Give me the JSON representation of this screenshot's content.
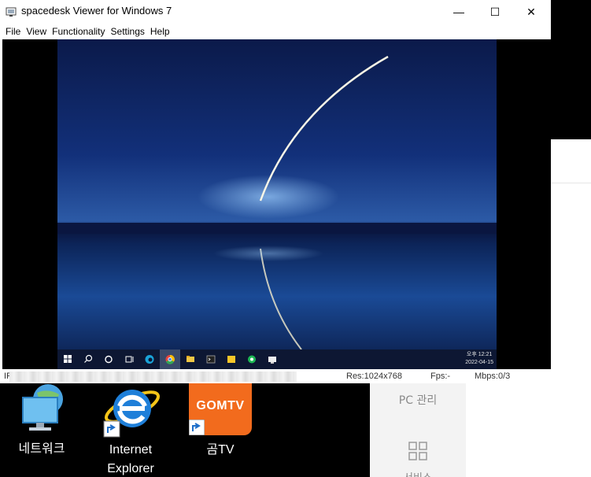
{
  "window": {
    "title": "spacedesk Viewer for Windows 7",
    "min_glyph": "—",
    "max_glyph": "☐",
    "close_glyph": "✕"
  },
  "menu": [
    "File",
    "View",
    "Functionality",
    "Settings",
    "Help"
  ],
  "remote": {
    "clock_time": "오후 12:21",
    "clock_date": "2022-04-15",
    "taskbar_icons": [
      "windows-start-icon",
      "search-icon",
      "cortana-icon",
      "task-view-icon",
      "edge-icon",
      "chrome-icon",
      "file-explorer-icon",
      "terminal-icon",
      "sticky-notes-icon",
      "green-app-icon",
      "spacedesk-icon"
    ]
  },
  "status": {
    "ip_label": "IP",
    "res": "Res:1024x768",
    "fps": "Fps:-",
    "mbps": "Mbps:0/3"
  },
  "desktop": {
    "network_label": "네트워크",
    "ie_label_line1": "Internet",
    "ie_label_line2": "Explorer",
    "gomtv_label": "곰TV",
    "gomtv_logo_text": "GOMTV"
  },
  "side_panel": {
    "pc_label": "PC 관리",
    "services_label": "서비스"
  },
  "colors": {
    "gomtv_orange": "#f26b1d",
    "ie_blue": "#1e7fd9",
    "taskbar": "#0d1733"
  }
}
